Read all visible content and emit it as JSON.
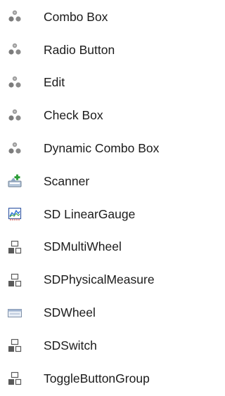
{
  "toolbox": {
    "items": [
      {
        "label": "Combo Box",
        "icon": "user-control-icon"
      },
      {
        "label": "Radio Button",
        "icon": "user-control-icon"
      },
      {
        "label": "Edit",
        "icon": "user-control-icon"
      },
      {
        "label": "Check Box",
        "icon": "user-control-icon"
      },
      {
        "label": "Dynamic Combo Box",
        "icon": "user-control-icon"
      },
      {
        "label": "Scanner",
        "icon": "scanner-icon"
      },
      {
        "label": "SD LinearGauge",
        "icon": "chart-icon"
      },
      {
        "label": "SDMultiWheel",
        "icon": "component-icon"
      },
      {
        "label": "SDPhysicalMeasure",
        "icon": "component-icon"
      },
      {
        "label": "SDWheel",
        "icon": "panel-icon"
      },
      {
        "label": "SDSwitch",
        "icon": "component-icon"
      },
      {
        "label": "ToggleButtonGroup",
        "icon": "component-icon"
      }
    ]
  },
  "colors": {
    "text": "#1b1b1b",
    "icon_gray": "#8a8a8a",
    "icon_dark": "#5a5a5a",
    "accent_green": "#2f9e3a",
    "accent_blue": "#2b6fd6",
    "accent_red": "#d23b2b"
  }
}
